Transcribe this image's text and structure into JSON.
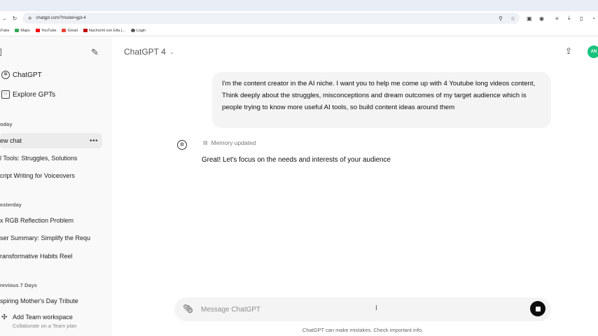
{
  "browser": {
    "url": "chatgpt.com/?model=gpt-4",
    "bookmarks": [
      {
        "label": "uTube",
        "color": "#ff0000"
      },
      {
        "label": "Maps",
        "color": "#34a853"
      },
      {
        "label": "YouTube",
        "color": "#ff0000"
      },
      {
        "label": "Gmail",
        "color": "#ea4335"
      },
      {
        "label": "Nachricht von Ella |...",
        "color": "#c00000"
      },
      {
        "label": "Login",
        "color": "#555555"
      }
    ]
  },
  "sidebar": {
    "links": [
      {
        "label": "ChatGPT"
      },
      {
        "label": "Explore GPTs"
      }
    ],
    "sections": [
      {
        "title": "oday",
        "items": [
          "ew chat",
          "l Tools: Struggles, Solutions",
          "cript Writing for Voiceovers"
        ]
      },
      {
        "title": "esterday",
        "items": [
          "x RGB Reflection Problem",
          "ser Summary: Simplify the Requ",
          "ransformative Habits Reel"
        ]
      },
      {
        "title": "revious 7 Days",
        "items": [
          "spiring Mother's Day Tribute"
        ]
      }
    ],
    "item_more": "•••",
    "footer": {
      "title": "Add Team workspace",
      "subtitle": "Collaborate on a Team plan"
    }
  },
  "main": {
    "model_label": "ChatGPT 4",
    "avatar_initials": "AN",
    "user_message": "I'm the content creator in the AI niche. I want you to help me come up with 4 Youtube long videos content, Think deeply about the struggles, misconceptions and dream outcomes of my target audience which is people trying to know more useful AI tools, so build content ideas around them",
    "memory_label": "Memory updated",
    "assistant_message": "Great! Let's focus on the needs and interests of your audience",
    "composer_placeholder": "Message ChatGPT",
    "disclaimer": "ChatGPT can make mistakes. Check important info."
  },
  "colors": {
    "sidebar_bg": "#f9f9f9",
    "bubble_bg": "#f4f4f4",
    "avatar_bg": "#19c37d"
  }
}
